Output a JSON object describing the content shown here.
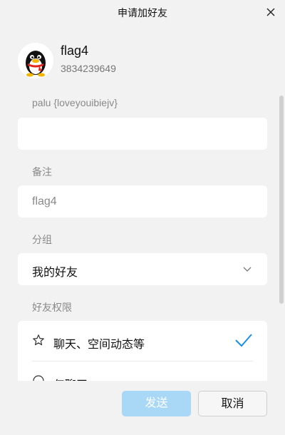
{
  "window": {
    "title": "申请加好友"
  },
  "profile": {
    "nickname": "flag4",
    "qq_number": "3834239649"
  },
  "verification": {
    "label": "palu {loveyouibiejv}",
    "value": ""
  },
  "remark": {
    "label": "备注",
    "placeholder": "flag4",
    "value": ""
  },
  "group": {
    "label": "分组",
    "selected": "我的好友"
  },
  "permissions": {
    "label": "好友权限",
    "options": [
      {
        "label": "聊天、空间动态等",
        "selected": true
      },
      {
        "label": "仅聊天",
        "selected": false
      }
    ]
  },
  "footer": {
    "send_label": "发送",
    "cancel_label": "取消"
  },
  "colors": {
    "accent": "#1a8fe8",
    "send_disabled": "#a9d8f7",
    "background": "#f2f2f2"
  }
}
